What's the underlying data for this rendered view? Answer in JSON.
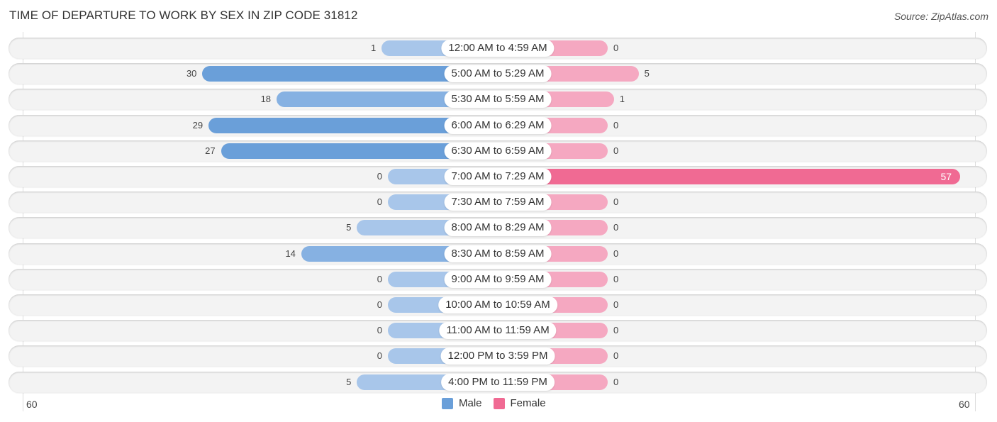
{
  "header": {
    "title": "TIME OF DEPARTURE TO WORK BY SEX IN ZIP CODE 31812",
    "source": "Source: ZipAtlas.com"
  },
  "colors": {
    "male": "#6a9fd9",
    "male_light": "#a8c6ea",
    "female": "#f06a93",
    "female_light": "#f5a8c1"
  },
  "chart_data": {
    "type": "bar",
    "orientation": "horizontal-diverging",
    "title": "TIME OF DEPARTURE TO WORK BY SEX IN ZIP CODE 31812",
    "categories": [
      "12:00 AM to 4:59 AM",
      "5:00 AM to 5:29 AM",
      "5:30 AM to 5:59 AM",
      "6:00 AM to 6:29 AM",
      "6:30 AM to 6:59 AM",
      "7:00 AM to 7:29 AM",
      "7:30 AM to 7:59 AM",
      "8:00 AM to 8:29 AM",
      "8:30 AM to 8:59 AM",
      "9:00 AM to 9:59 AM",
      "10:00 AM to 10:59 AM",
      "11:00 AM to 11:59 AM",
      "12:00 PM to 3:59 PM",
      "4:00 PM to 11:59 PM"
    ],
    "series": [
      {
        "name": "Male",
        "values": [
          1,
          30,
          18,
          29,
          27,
          0,
          0,
          5,
          14,
          0,
          0,
          0,
          0,
          5
        ]
      },
      {
        "name": "Female",
        "values": [
          0,
          5,
          1,
          0,
          0,
          57,
          0,
          0,
          0,
          0,
          0,
          0,
          0,
          0
        ]
      }
    ],
    "axis": {
      "left_tick": "60",
      "right_tick": "60",
      "xlim": [
        60,
        60
      ]
    },
    "legend": {
      "placement": "bottom-center",
      "entries": [
        "Male",
        "Female"
      ]
    },
    "grid": false
  }
}
